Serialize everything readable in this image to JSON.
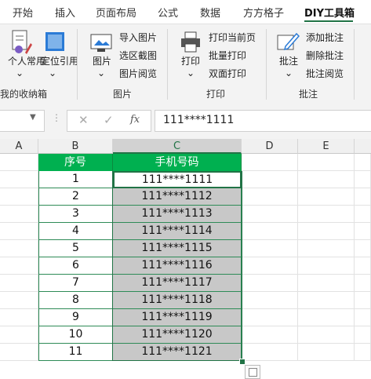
{
  "ribbon_tabs": [
    "开始",
    "插入",
    "页面布局",
    "公式",
    "数据",
    "方方格子",
    "DIY工具箱"
  ],
  "active_tab": "DIY工具箱",
  "accent_color": "#217346",
  "groups": {
    "favorites": {
      "label": "我的收纳箱",
      "visible_label": "我的收纳箱",
      "buttons": [
        "个人常用",
        "定位引用"
      ]
    },
    "picture": {
      "label": "图片",
      "big_button": "图片",
      "items": [
        "导入图片",
        "选区截图",
        "图片阅览"
      ]
    },
    "print": {
      "label": "打印",
      "big_button": "打印",
      "items": [
        "打印当前页",
        "批量打印",
        "双面打印"
      ]
    },
    "comment": {
      "label": "批注",
      "big_button": "批注",
      "items": [
        "添加批注",
        "删除批注",
        "批注阅览"
      ]
    }
  },
  "formula_bar": {
    "name_box": "",
    "fx_symbol": "fx",
    "value": "111****1111"
  },
  "columns": [
    "A",
    "B",
    "C",
    "D",
    "E"
  ],
  "selected_column": "C",
  "table": {
    "headers": [
      "序号",
      "手机号码"
    ],
    "header_color": "#00b050",
    "rows": [
      [
        "1",
        "111****1111"
      ],
      [
        "2",
        "111****1112"
      ],
      [
        "3",
        "111****1113"
      ],
      [
        "4",
        "111****1114"
      ],
      [
        "5",
        "111****1115"
      ],
      [
        "6",
        "111****1116"
      ],
      [
        "7",
        "111****1117"
      ],
      [
        "8",
        "111****1118"
      ],
      [
        "9",
        "111****1119"
      ],
      [
        "10",
        "111****1120"
      ],
      [
        "11",
        "111****1121"
      ]
    ]
  }
}
